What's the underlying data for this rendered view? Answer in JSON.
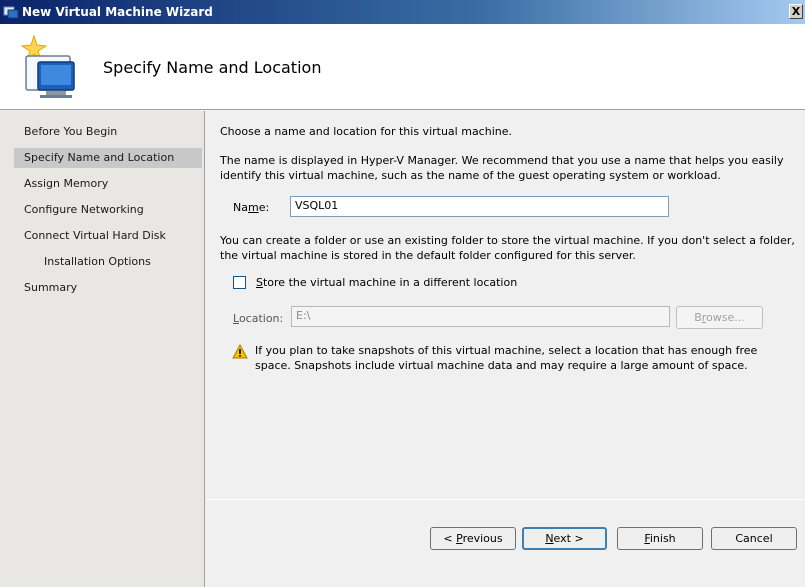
{
  "window": {
    "title": "New Virtual Machine Wizard",
    "close_glyph": "X"
  },
  "header": {
    "heading": "Specify Name and Location"
  },
  "nav": {
    "items": [
      {
        "label": "Before You Begin"
      },
      {
        "label": "Specify Name and Location",
        "selected": true
      },
      {
        "label": "Assign Memory"
      },
      {
        "label": "Configure Networking"
      },
      {
        "label": "Connect Virtual Hard Disk"
      },
      {
        "label": "Installation Options"
      },
      {
        "label": "Summary"
      }
    ]
  },
  "main": {
    "intro": "Choose a name and location for this virtual machine.",
    "description": "The name is displayed in Hyper-V Manager. We recommend that you use a name that helps you easily identify this virtual machine, such as the name of the guest operating system or workload.",
    "name_label_pre": "Na",
    "name_label_access": "m",
    "name_label_post": "e:",
    "name_value": "VSQL01",
    "folder_text": "You can create a folder or use an existing folder to store the virtual machine. If you don't select a folder, the virtual machine is stored in the default folder configured for this server.",
    "store_access": "S",
    "store_rest": "tore the virtual machine in a different location",
    "store_checked": false,
    "location_access": "L",
    "location_rest": "ocation:",
    "location_value": "E:\\",
    "browse_access": "r",
    "browse_pre": "B",
    "browse_post": "owse...",
    "warning_text": "If you plan to take snapshots of this virtual machine, select a location that has enough free space. Snapshots include virtual machine data and may require a large amount of space."
  },
  "footer": {
    "previous_pre": "< ",
    "previous_access": "P",
    "previous_post": "revious",
    "next_access": "N",
    "next_post": "ext >",
    "finish_access": "F",
    "finish_post": "inish",
    "cancel_label": "Cancel"
  },
  "colors": {
    "titlebar": "#0a246a",
    "nav_background": "#e9e7e3",
    "nav_selected": "#c8c8c8",
    "warning": "#f2c200"
  }
}
